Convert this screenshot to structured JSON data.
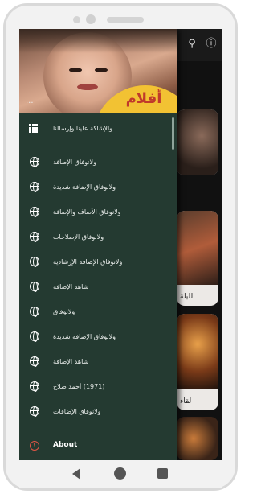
{
  "header": {
    "logo_text": "أفلام",
    "dots": "..."
  },
  "menu": {
    "items": [
      {
        "label": "والإشاكة علينا وإرسالنا",
        "icon": "grid-icon"
      },
      {
        "label": "ولانوفاق الإضافة",
        "icon": "globe-icon"
      },
      {
        "label": "ولانوفاق الإضافة شديدة",
        "icon": "globe-icon"
      },
      {
        "label": "ولانوفاق الأضاف والإضافة",
        "icon": "globe-icon"
      },
      {
        "label": "ولانوفاق الإصلاحات",
        "icon": "globe-icon"
      },
      {
        "label": "ولانوفاق الإضافة الإرشادية",
        "icon": "globe-icon"
      },
      {
        "label": "شاهد الإضافة",
        "icon": "globe-icon"
      },
      {
        "label": "ولانوفاق",
        "icon": "globe-icon"
      },
      {
        "label": "ولانوفاق الإضافة شديدة",
        "icon": "globe-icon"
      },
      {
        "label": "شاهد الإضافة",
        "icon": "globe-icon"
      },
      {
        "label": "(1971) أحمد صلاح",
        "icon": "globe-icon"
      },
      {
        "label": "ولانوفاق الإضافات",
        "icon": "globe-icon"
      }
    ],
    "about_label": "About",
    "about_icon_glyph": "!"
  },
  "background": {
    "appbar_icons": [
      "search-icon",
      "info-icon"
    ],
    "card_captions": [
      "",
      "الليلة",
      "",
      "لقاء"
    ]
  },
  "colors": {
    "drawer_bg": "#243a31",
    "logo_bg": "#f2c233",
    "logo_text": "#c0392b",
    "about_icon": "#e05545"
  }
}
